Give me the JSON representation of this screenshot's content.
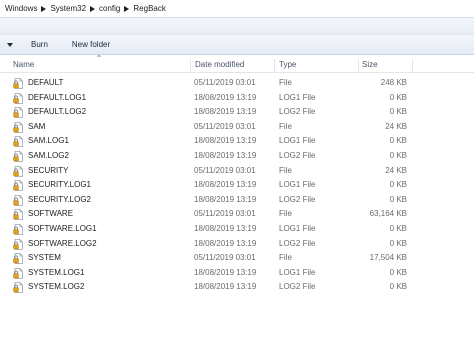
{
  "address": {
    "crumbs": [
      "Windows",
      "System32",
      "config",
      "RegBack"
    ]
  },
  "toolbar": {
    "burn_label": "Burn",
    "new_folder_label": "New folder"
  },
  "columns": {
    "name": "Name",
    "date": "Date modified",
    "type": "Type",
    "size": "Size"
  },
  "files": [
    {
      "name": "DEFAULT",
      "date": "05/11/2019 03:01",
      "type": "File",
      "size": "248 KB"
    },
    {
      "name": "DEFAULT.LOG1",
      "date": "18/08/2019 13:19",
      "type": "LOG1 File",
      "size": "0 KB"
    },
    {
      "name": "DEFAULT.LOG2",
      "date": "18/08/2019 13:19",
      "type": "LOG2 File",
      "size": "0 KB"
    },
    {
      "name": "SAM",
      "date": "05/11/2019 03:01",
      "type": "File",
      "size": "24 KB"
    },
    {
      "name": "SAM.LOG1",
      "date": "18/08/2019 13:19",
      "type": "LOG1 File",
      "size": "0 KB"
    },
    {
      "name": "SAM.LOG2",
      "date": "18/08/2019 13:19",
      "type": "LOG2 File",
      "size": "0 KB"
    },
    {
      "name": "SECURITY",
      "date": "05/11/2019 03:01",
      "type": "File",
      "size": "24 KB"
    },
    {
      "name": "SECURITY.LOG1",
      "date": "18/08/2019 13:19",
      "type": "LOG1 File",
      "size": "0 KB"
    },
    {
      "name": "SECURITY.LOG2",
      "date": "18/08/2019 13:19",
      "type": "LOG2 File",
      "size": "0 KB"
    },
    {
      "name": "SOFTWARE",
      "date": "05/11/2019 03:01",
      "type": "File",
      "size": "63,164 KB"
    },
    {
      "name": "SOFTWARE.LOG1",
      "date": "18/08/2019 13:19",
      "type": "LOG1 File",
      "size": "0 KB"
    },
    {
      "name": "SOFTWARE.LOG2",
      "date": "18/08/2019 13:19",
      "type": "LOG2 File",
      "size": "0 KB"
    },
    {
      "name": "SYSTEM",
      "date": "05/11/2019 03:01",
      "type": "File",
      "size": "17,504 KB"
    },
    {
      "name": "SYSTEM.LOG1",
      "date": "18/08/2019 13:19",
      "type": "LOG1 File",
      "size": "0 KB"
    },
    {
      "name": "SYSTEM.LOG2",
      "date": "18/08/2019 13:19",
      "type": "LOG2 File",
      "size": "0 KB"
    }
  ],
  "icons": {
    "crumb_separator": "chevron-right-icon",
    "toolbar_dropdown": "triangle-down-icon",
    "sort": "sort-ascending-icon",
    "file": "locked-file-icon"
  },
  "colors": {
    "toolbar_top": "#f4f7fb",
    "toolbar_bottom": "#e3eaf4",
    "secondary_text": "#6b6b6b",
    "lock": "#e0a21a"
  }
}
